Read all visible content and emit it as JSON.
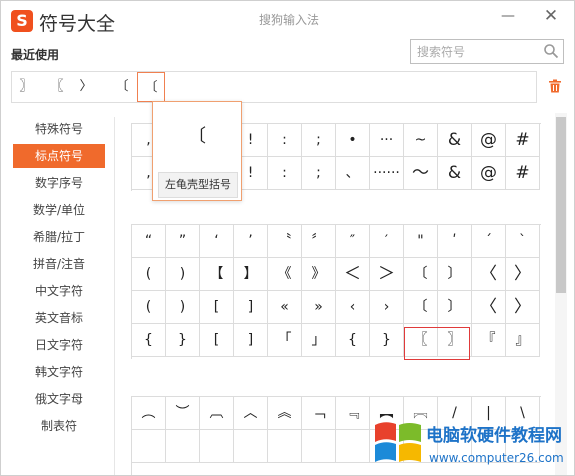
{
  "window": {
    "title": "符号大全",
    "subtitle": "搜狗输入法",
    "logo": "S",
    "minimize_label": "—",
    "close_label": "✕"
  },
  "recent": {
    "label": "最近使用",
    "items": [
      "〗",
      "〖",
      "〉",
      "〔",
      "〔"
    ]
  },
  "search": {
    "placeholder": "搜索符号"
  },
  "sidebar": {
    "items": [
      "特殊符号",
      "标点符号",
      "数字序号",
      "数学/单位",
      "希腊/拉丁",
      "拼音/注音",
      "中文字符",
      "英文音标",
      "日文字符",
      "韩文字符",
      "俄文字母",
      "制表符"
    ]
  },
  "grid1": {
    "rows": [
      [
        ",",
        "",
        "",
        "!",
        ":",
        ";",
        "•",
        "···",
        "~",
        "&",
        "@",
        "#"
      ],
      [
        ",",
        "",
        "",
        "!",
        ":",
        ";",
        "、",
        "······",
        "～",
        "&",
        "@",
        "#"
      ]
    ]
  },
  "grid2": {
    "rows": [
      [
        "“",
        "”",
        "‘",
        "’",
        "〝",
        "〞",
        "″",
        "′",
        "\"",
        "ʹ",
        "ˊ",
        "ˋ"
      ],
      [
        "(",
        ")",
        "【",
        "】",
        "《",
        "》",
        "＜",
        "＞",
        "〔",
        "〕",
        "〈",
        "〉"
      ],
      [
        "(",
        ")",
        "[",
        "]",
        "«",
        "»",
        "‹",
        "›",
        "〔",
        "〕",
        "〈",
        "〉"
      ],
      [
        "{",
        "}",
        "[",
        "]",
        "「",
        "」",
        "{",
        "}",
        "〖",
        "〗",
        "『",
        "』"
      ]
    ]
  },
  "grid3": {
    "rows": [
      [
        "︵",
        "︶",
        "︹",
        "︿",
        "︽",
        "﹁",
        "﹃",
        "︻",
        "︗",
        "/",
        "|",
        "\\"
      ],
      [
        "",
        "",
        "",
        "",
        "",
        "",
        "",
        "",
        "",
        "",
        "",
        ""
      ]
    ]
  },
  "popup": {
    "symbol": "〔",
    "name": "左龟壳型括号"
  },
  "watermark": {
    "title": "电脑软硬件教程网",
    "url": "www.computer26.com"
  },
  "colors": {
    "accent": "#f06a2c",
    "highlight": "#e03a3a",
    "watermark": "#1e73c8"
  }
}
